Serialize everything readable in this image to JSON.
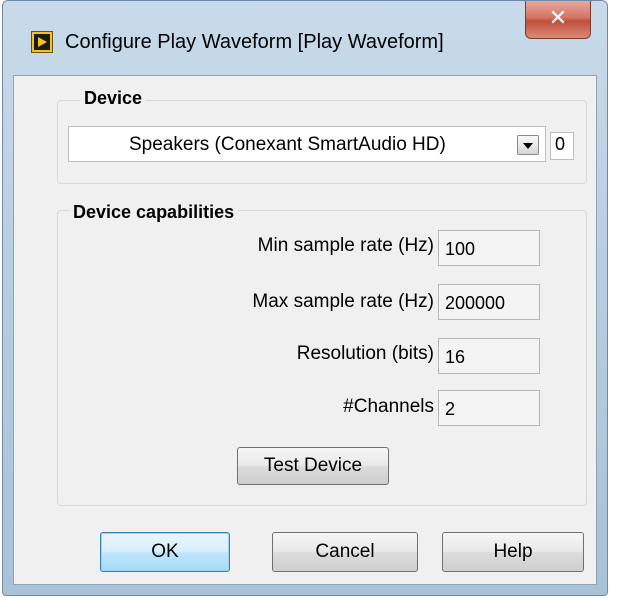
{
  "window": {
    "title": "Configure Play Waveform [Play Waveform]",
    "close_glyph": "✕"
  },
  "device_group": {
    "label": "Device",
    "selected_device": "Speakers (Conexant SmartAudio HD)",
    "device_index": "0"
  },
  "capabilities_group": {
    "label": "Device capabilities",
    "fields": [
      {
        "label": "Min sample rate (Hz)",
        "value": "100"
      },
      {
        "label": "Max sample rate (Hz)",
        "value": "200000"
      },
      {
        "label": "Resolution (bits)",
        "value": "16"
      },
      {
        "label": "#Channels",
        "value": "2"
      }
    ],
    "test_button": "Test Device"
  },
  "footer": {
    "ok": "OK",
    "cancel": "Cancel",
    "help": "Help"
  },
  "colors": {
    "accent": "#3c7fb1",
    "close": "#c0503c",
    "dialog_bg": "#f0f0f0"
  }
}
